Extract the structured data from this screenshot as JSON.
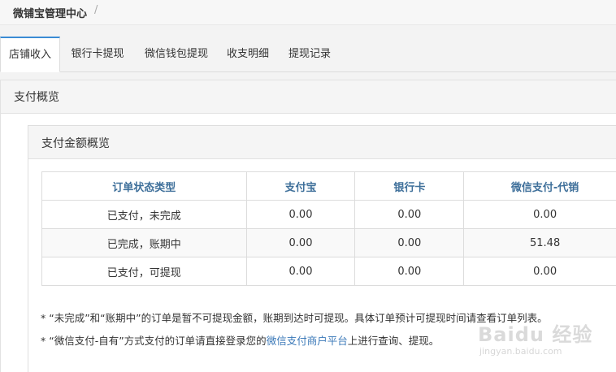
{
  "breadcrumb": {
    "title": "微铺宝管理中心",
    "separator": "/"
  },
  "tabs": [
    {
      "label": "店铺收入"
    },
    {
      "label": "银行卡提现"
    },
    {
      "label": "微信钱包提现"
    },
    {
      "label": "收支明细"
    },
    {
      "label": "提现记录"
    }
  ],
  "panel": {
    "title": "支付概览"
  },
  "inner": {
    "title": "支付金额概览",
    "table": {
      "headers": [
        "订单状态类型",
        "支付宝",
        "银行卡",
        "微信支付-代销"
      ],
      "rows": [
        [
          "已支付，未完成",
          "0.00",
          "0.00",
          "0.00"
        ],
        [
          "已完成，账期中",
          "0.00",
          "0.00",
          "51.48"
        ],
        [
          "已支付，可提现",
          "0.00",
          "0.00",
          "0.00"
        ]
      ]
    },
    "notes": {
      "note1": "* “未完成”和“账期中”的订单是暂不可提现金额，账期到达时可提现。具体订单预计可提现时间请查看订单列表。",
      "note2_prefix": "* “微信支付-自有”方式支付的订单请直接登录您的",
      "note2_link": "微信支付商户平台",
      "note2_suffix": "上进行查询、提现。"
    }
  },
  "watermark": {
    "logo": "Baidu 经验",
    "sub": "jingyan.baidu.com"
  }
}
